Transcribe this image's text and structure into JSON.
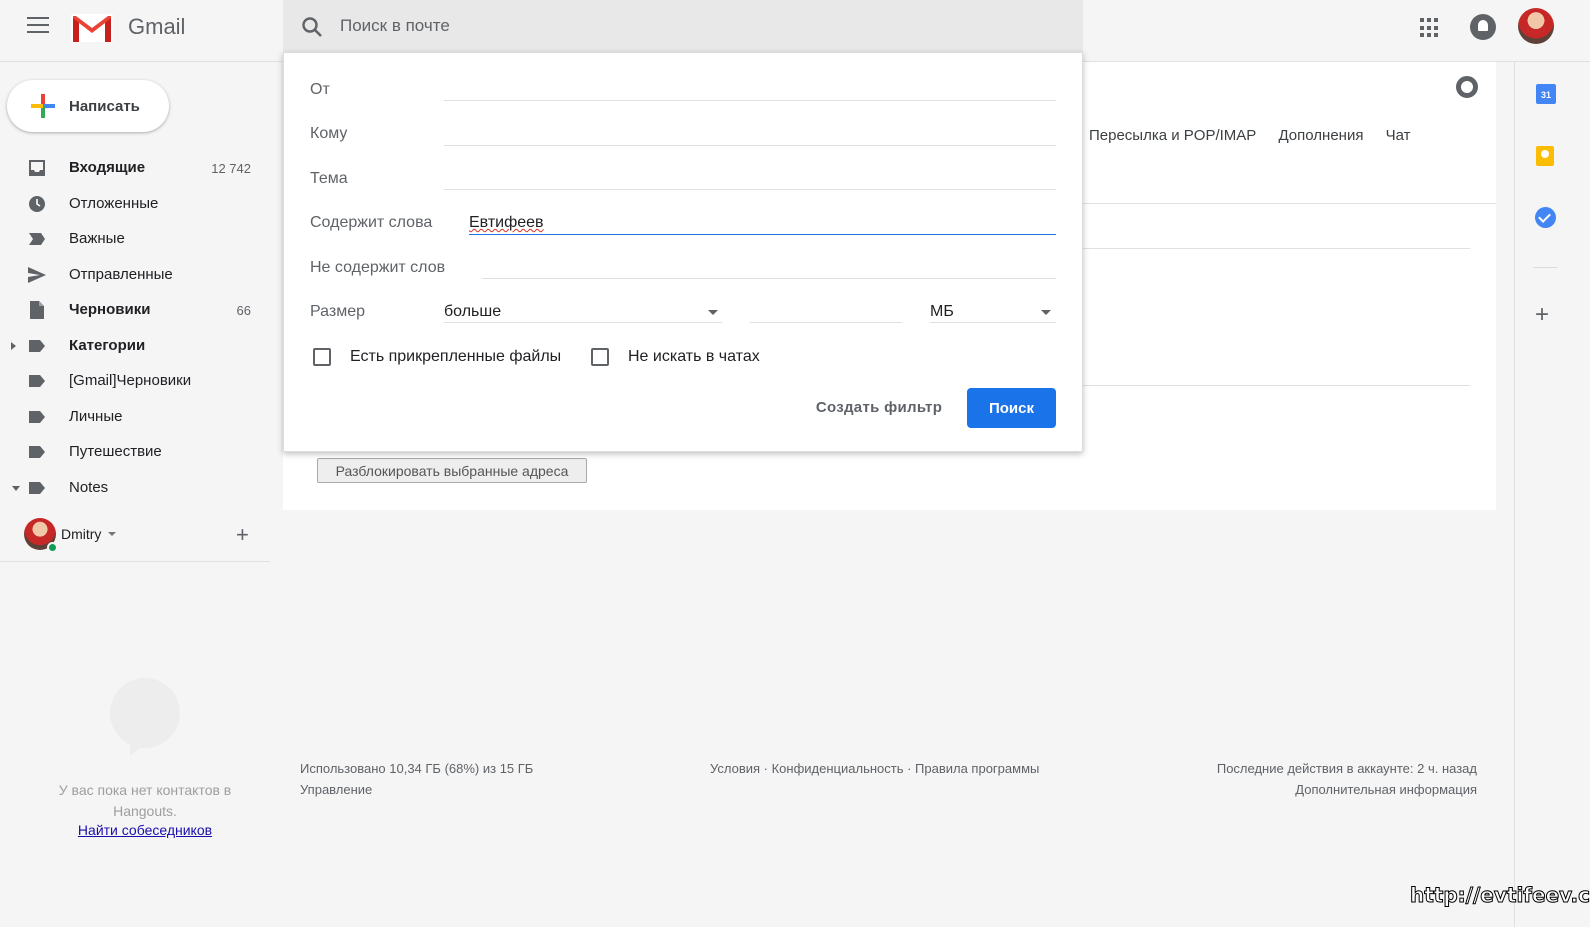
{
  "header": {
    "app_name": "Gmail",
    "search_placeholder": "Поиск в почте"
  },
  "compose": {
    "label": "Написать"
  },
  "sidebar": {
    "items": [
      {
        "label": "Входящие",
        "count": "12 742",
        "bold": true,
        "icon": "inbox-icon"
      },
      {
        "label": "Отложенные",
        "count": "",
        "bold": false,
        "icon": "clock-icon"
      },
      {
        "label": "Важные",
        "count": "",
        "bold": false,
        "icon": "important-icon"
      },
      {
        "label": "Отправленные",
        "count": "",
        "bold": false,
        "icon": "send-icon"
      },
      {
        "label": "Черновики",
        "count": "66",
        "bold": true,
        "icon": "draft-icon"
      },
      {
        "label": "Категории",
        "count": "",
        "bold": true,
        "icon": "label-icon"
      },
      {
        "label": "[Gmail]Черновики",
        "count": "",
        "bold": false,
        "icon": "label-icon"
      },
      {
        "label": "Личные",
        "count": "",
        "bold": false,
        "icon": "label-icon"
      },
      {
        "label": "Путешествие",
        "count": "",
        "bold": false,
        "icon": "label-icon"
      },
      {
        "label": "Notes",
        "count": "",
        "bold": false,
        "icon": "label-icon"
      }
    ]
  },
  "hangouts": {
    "user_name": "Dmitry",
    "empty_text": "У вас пока нет контактов в Hangouts.",
    "find_link": "Найти собеседников"
  },
  "settings": {
    "tabs": [
      "Пересылка и POP/IMAP",
      "Дополнения",
      "Чат"
    ],
    "unblock_button": "Разблокировать выбранные адреса"
  },
  "search_options": {
    "from_label": "От",
    "from_value": "",
    "to_label": "Кому",
    "to_value": "",
    "subject_label": "Тема",
    "subject_value": "",
    "has_words_label": "Содержит слова",
    "has_words_value": "Евтифеев",
    "not_words_label": "Не содержит слов",
    "not_words_value": "",
    "size_label": "Размер",
    "size_operator": "больше",
    "size_value": "",
    "size_unit": "МБ",
    "has_attachment_label": "Есть прикрепленные файлы",
    "has_attachment_checked": false,
    "exclude_chats_label": "Не искать в чатах",
    "exclude_chats_checked": false,
    "create_filter_button": "Создать фильтр",
    "search_button": "Поиск"
  },
  "footer": {
    "storage": "Использовано 10,34 ГБ (68%) из 15 ГБ",
    "manage": "Управление",
    "links": "Условия · Конфиденциальность · Правила программы",
    "last_activity": "Последние действия в аккаунте: 2 ч. назад",
    "details": "Дополнительная информация"
  },
  "side_panel": {
    "calendar_day": "31"
  },
  "watermark": "http://evtifeev.com",
  "colors": {
    "accent": "#1a73e8",
    "gmail_red": "#ea4335",
    "online": "#0f9d58"
  }
}
